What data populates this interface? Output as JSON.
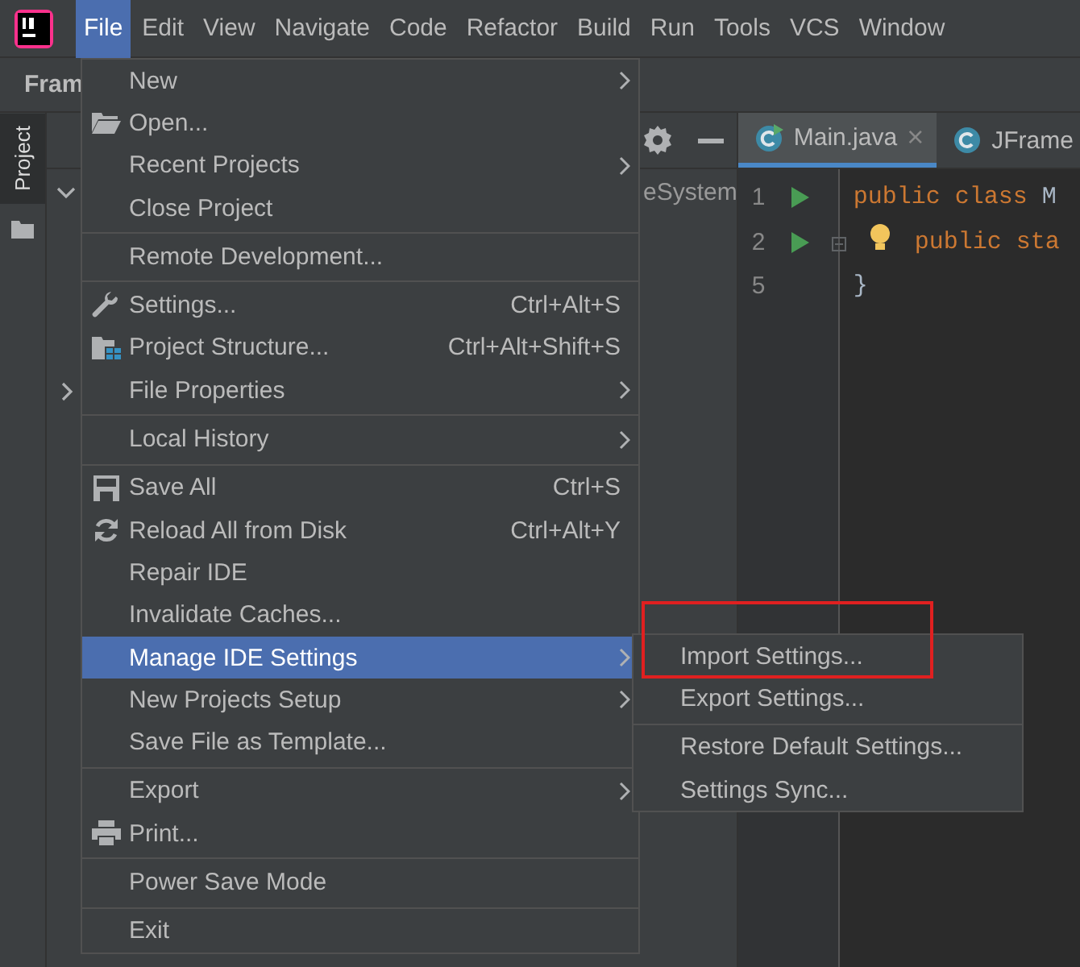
{
  "menubar": [
    {
      "label": "File",
      "selected": true
    },
    {
      "label": "Edit",
      "selected": false
    },
    {
      "label": "View",
      "selected": false
    },
    {
      "label": "Navigate",
      "selected": false
    },
    {
      "label": "Code",
      "selected": false
    },
    {
      "label": "Refactor",
      "selected": false
    },
    {
      "label": "Build",
      "selected": false
    },
    {
      "label": "Run",
      "selected": false
    },
    {
      "label": "Tools",
      "selected": false
    },
    {
      "label": "VCS",
      "selected": false
    },
    {
      "label": "Window",
      "selected": false
    }
  ],
  "toolbar": {
    "title": "Fram"
  },
  "tool_stripe": [
    {
      "label": "Project",
      "selected": true
    }
  ],
  "project_panel": {
    "tree": [
      {
        "text": "eSystem",
        "expanded": true
      },
      {
        "expanded": false
      }
    ]
  },
  "editor": {
    "tabs": [
      {
        "label": "Main.java",
        "selected": true,
        "close": "×"
      },
      {
        "label": "JFrame",
        "selected": false
      }
    ],
    "lines": [
      {
        "number": "1",
        "run": true,
        "fold": false,
        "bulb": false,
        "segments": [
          {
            "kind": "keyword",
            "text": "public class"
          },
          {
            "kind": "plain",
            "text": " M"
          }
        ]
      },
      {
        "number": "2",
        "run": true,
        "fold": true,
        "bulb": true,
        "segments": [
          {
            "kind": "keyword",
            "text": "public sta"
          }
        ]
      },
      {
        "number": "5",
        "run": false,
        "fold": false,
        "bulb": false,
        "segments": [
          {
            "kind": "plain",
            "text": "}"
          }
        ]
      }
    ]
  },
  "file_menu": {
    "groups": [
      [
        {
          "label": "New",
          "submenu": true,
          "selected": false
        },
        {
          "label": "Open...",
          "submenu": false,
          "selected": false
        },
        {
          "label": "Recent Projects",
          "submenu": true,
          "selected": false
        },
        {
          "label": "Close Project",
          "submenu": false,
          "selected": false
        }
      ],
      [
        {
          "label": "Remote Development...",
          "submenu": false,
          "selected": false
        }
      ],
      [
        {
          "label": "Settings...",
          "shortcut": "Ctrl+Alt+S",
          "submenu": false,
          "selected": false
        },
        {
          "label": "Project Structure...",
          "shortcut": "Ctrl+Alt+Shift+S",
          "submenu": false,
          "selected": false
        },
        {
          "label": "File Properties",
          "submenu": true,
          "selected": false
        }
      ],
      [
        {
          "label": "Local History",
          "submenu": true,
          "selected": false
        }
      ],
      [
        {
          "label": "Save All",
          "shortcut": "Ctrl+S",
          "submenu": false,
          "selected": false
        },
        {
          "label": "Reload All from Disk",
          "shortcut": "Ctrl+Alt+Y",
          "submenu": false,
          "selected": false
        },
        {
          "label": "Repair IDE",
          "submenu": false,
          "selected": false
        },
        {
          "label": "Invalidate Caches...",
          "submenu": false,
          "selected": false
        },
        {
          "label": "Manage IDE Settings",
          "submenu": true,
          "selected": true
        },
        {
          "label": "New Projects Setup",
          "submenu": true,
          "selected": false
        },
        {
          "label": "Save File as Template...",
          "submenu": false,
          "selected": false
        }
      ],
      [
        {
          "label": "Export",
          "submenu": true,
          "selected": false
        },
        {
          "label": "Print...",
          "submenu": false,
          "selected": false
        }
      ],
      [
        {
          "label": "Power Save Mode",
          "submenu": false,
          "selected": false
        }
      ],
      [
        {
          "label": "Exit",
          "submenu": false,
          "selected": false
        }
      ]
    ]
  },
  "submenu": {
    "groups": [
      [
        {
          "label": "Import Settings...",
          "selected": false
        },
        {
          "label": "Export Settings...",
          "selected": false
        }
      ],
      [
        {
          "label": "Restore Default Settings...",
          "selected": false
        },
        {
          "label": "Settings Sync...",
          "selected": false
        }
      ]
    ]
  }
}
